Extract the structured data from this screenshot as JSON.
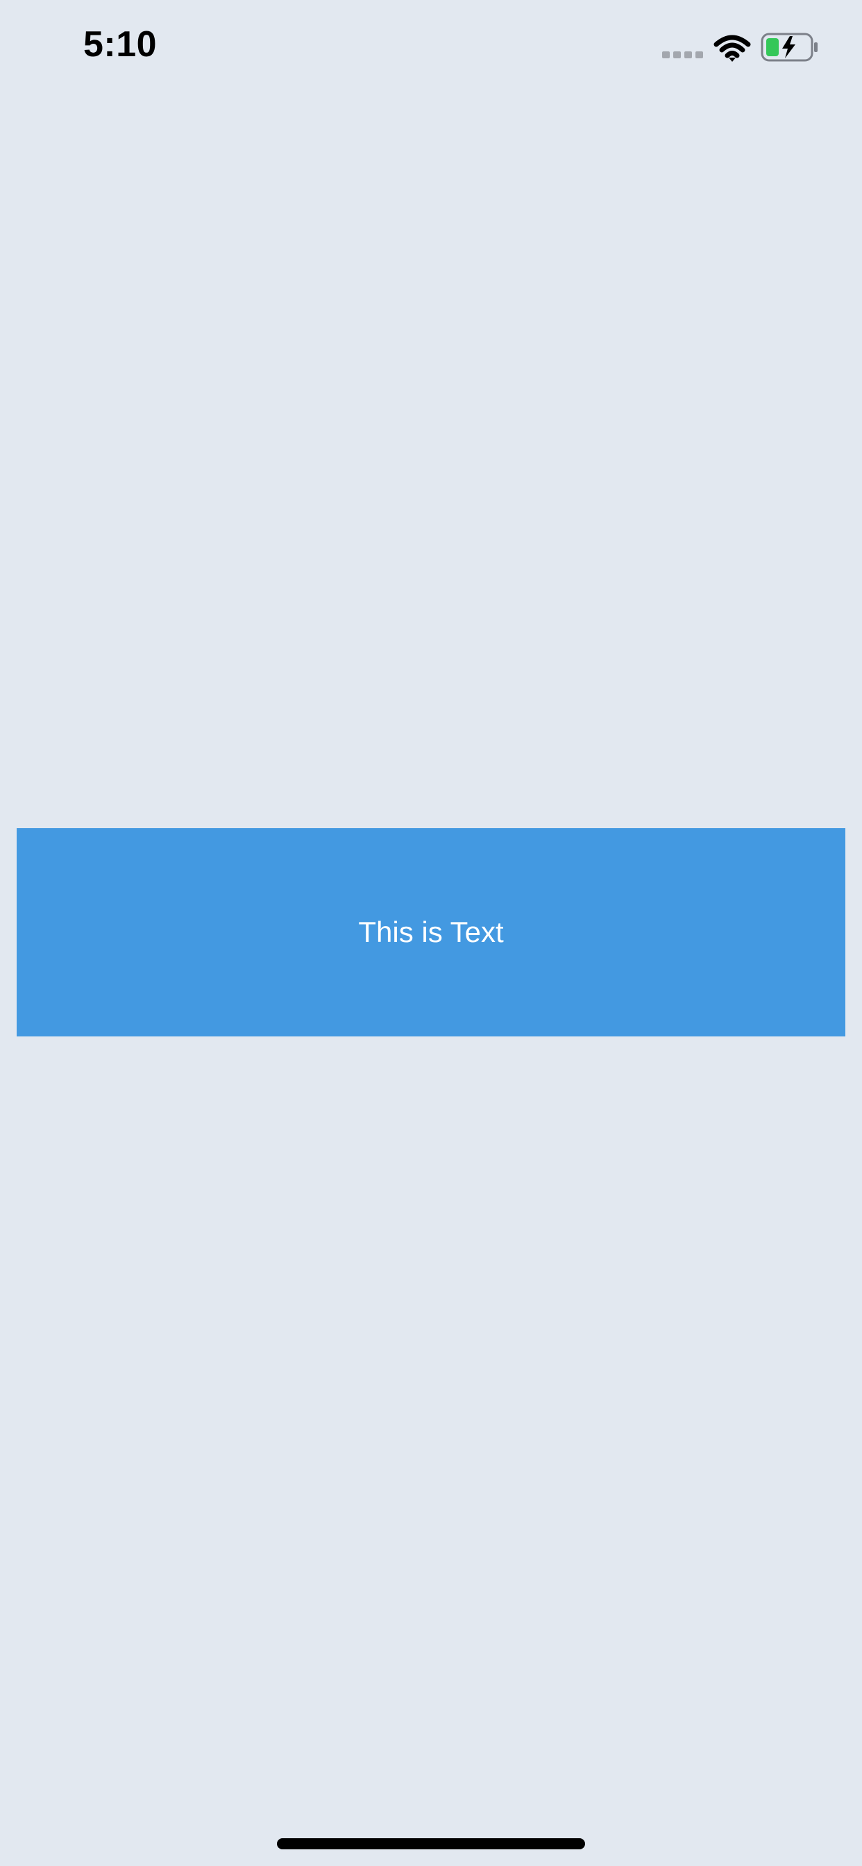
{
  "status_bar": {
    "time": "5:10",
    "icons": [
      "signal-icon",
      "wifi-icon",
      "battery-charging-icon"
    ],
    "battery_color": "#34C759"
  },
  "main": {
    "banner_text": "This is Text",
    "banner_color": "#4399E1",
    "background_color": "#E2E8F0"
  }
}
